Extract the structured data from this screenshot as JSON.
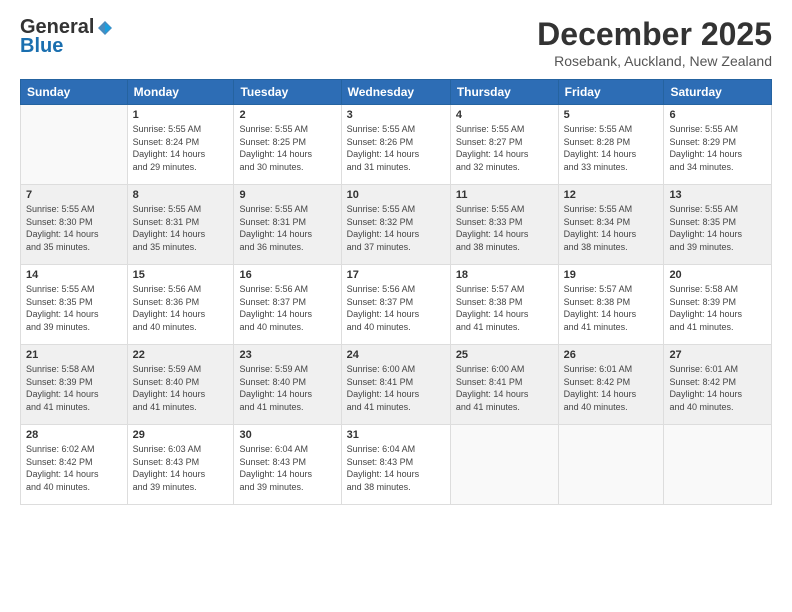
{
  "logo": {
    "general": "General",
    "blue": "Blue"
  },
  "title": "December 2025",
  "location": "Rosebank, Auckland, New Zealand",
  "days_of_week": [
    "Sunday",
    "Monday",
    "Tuesday",
    "Wednesday",
    "Thursday",
    "Friday",
    "Saturday"
  ],
  "weeks": [
    [
      {
        "num": "",
        "info": ""
      },
      {
        "num": "1",
        "info": "Sunrise: 5:55 AM\nSunset: 8:24 PM\nDaylight: 14 hours\nand 29 minutes."
      },
      {
        "num": "2",
        "info": "Sunrise: 5:55 AM\nSunset: 8:25 PM\nDaylight: 14 hours\nand 30 minutes."
      },
      {
        "num": "3",
        "info": "Sunrise: 5:55 AM\nSunset: 8:26 PM\nDaylight: 14 hours\nand 31 minutes."
      },
      {
        "num": "4",
        "info": "Sunrise: 5:55 AM\nSunset: 8:27 PM\nDaylight: 14 hours\nand 32 minutes."
      },
      {
        "num": "5",
        "info": "Sunrise: 5:55 AM\nSunset: 8:28 PM\nDaylight: 14 hours\nand 33 minutes."
      },
      {
        "num": "6",
        "info": "Sunrise: 5:55 AM\nSunset: 8:29 PM\nDaylight: 14 hours\nand 34 minutes."
      }
    ],
    [
      {
        "num": "7",
        "info": "Sunrise: 5:55 AM\nSunset: 8:30 PM\nDaylight: 14 hours\nand 35 minutes."
      },
      {
        "num": "8",
        "info": "Sunrise: 5:55 AM\nSunset: 8:31 PM\nDaylight: 14 hours\nand 35 minutes."
      },
      {
        "num": "9",
        "info": "Sunrise: 5:55 AM\nSunset: 8:31 PM\nDaylight: 14 hours\nand 36 minutes."
      },
      {
        "num": "10",
        "info": "Sunrise: 5:55 AM\nSunset: 8:32 PM\nDaylight: 14 hours\nand 37 minutes."
      },
      {
        "num": "11",
        "info": "Sunrise: 5:55 AM\nSunset: 8:33 PM\nDaylight: 14 hours\nand 38 minutes."
      },
      {
        "num": "12",
        "info": "Sunrise: 5:55 AM\nSunset: 8:34 PM\nDaylight: 14 hours\nand 38 minutes."
      },
      {
        "num": "13",
        "info": "Sunrise: 5:55 AM\nSunset: 8:35 PM\nDaylight: 14 hours\nand 39 minutes."
      }
    ],
    [
      {
        "num": "14",
        "info": "Sunrise: 5:55 AM\nSunset: 8:35 PM\nDaylight: 14 hours\nand 39 minutes."
      },
      {
        "num": "15",
        "info": "Sunrise: 5:56 AM\nSunset: 8:36 PM\nDaylight: 14 hours\nand 40 minutes."
      },
      {
        "num": "16",
        "info": "Sunrise: 5:56 AM\nSunset: 8:37 PM\nDaylight: 14 hours\nand 40 minutes."
      },
      {
        "num": "17",
        "info": "Sunrise: 5:56 AM\nSunset: 8:37 PM\nDaylight: 14 hours\nand 40 minutes."
      },
      {
        "num": "18",
        "info": "Sunrise: 5:57 AM\nSunset: 8:38 PM\nDaylight: 14 hours\nand 41 minutes."
      },
      {
        "num": "19",
        "info": "Sunrise: 5:57 AM\nSunset: 8:38 PM\nDaylight: 14 hours\nand 41 minutes."
      },
      {
        "num": "20",
        "info": "Sunrise: 5:58 AM\nSunset: 8:39 PM\nDaylight: 14 hours\nand 41 minutes."
      }
    ],
    [
      {
        "num": "21",
        "info": "Sunrise: 5:58 AM\nSunset: 8:39 PM\nDaylight: 14 hours\nand 41 minutes."
      },
      {
        "num": "22",
        "info": "Sunrise: 5:59 AM\nSunset: 8:40 PM\nDaylight: 14 hours\nand 41 minutes."
      },
      {
        "num": "23",
        "info": "Sunrise: 5:59 AM\nSunset: 8:40 PM\nDaylight: 14 hours\nand 41 minutes."
      },
      {
        "num": "24",
        "info": "Sunrise: 6:00 AM\nSunset: 8:41 PM\nDaylight: 14 hours\nand 41 minutes."
      },
      {
        "num": "25",
        "info": "Sunrise: 6:00 AM\nSunset: 8:41 PM\nDaylight: 14 hours\nand 41 minutes."
      },
      {
        "num": "26",
        "info": "Sunrise: 6:01 AM\nSunset: 8:42 PM\nDaylight: 14 hours\nand 40 minutes."
      },
      {
        "num": "27",
        "info": "Sunrise: 6:01 AM\nSunset: 8:42 PM\nDaylight: 14 hours\nand 40 minutes."
      }
    ],
    [
      {
        "num": "28",
        "info": "Sunrise: 6:02 AM\nSunset: 8:42 PM\nDaylight: 14 hours\nand 40 minutes."
      },
      {
        "num": "29",
        "info": "Sunrise: 6:03 AM\nSunset: 8:43 PM\nDaylight: 14 hours\nand 39 minutes."
      },
      {
        "num": "30",
        "info": "Sunrise: 6:04 AM\nSunset: 8:43 PM\nDaylight: 14 hours\nand 39 minutes."
      },
      {
        "num": "31",
        "info": "Sunrise: 6:04 AM\nSunset: 8:43 PM\nDaylight: 14 hours\nand 38 minutes."
      },
      {
        "num": "",
        "info": ""
      },
      {
        "num": "",
        "info": ""
      },
      {
        "num": "",
        "info": ""
      }
    ]
  ]
}
